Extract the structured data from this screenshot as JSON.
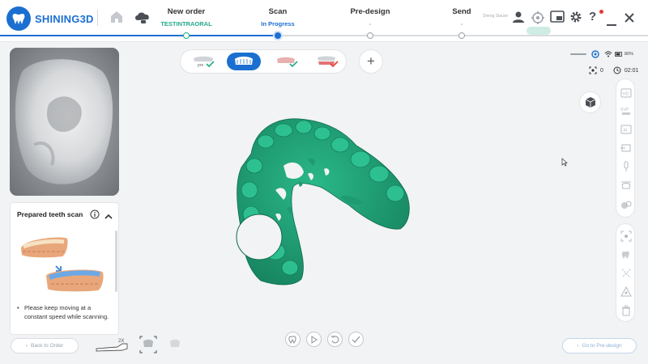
{
  "app": {
    "logo_text": "SHINING3D",
    "username": "Sheng Slause"
  },
  "steps": [
    {
      "title": "New order",
      "subtitle": "TESTINTRAORAL",
      "state": "done"
    },
    {
      "title": "Scan",
      "subtitle": "In Progress",
      "state": "active"
    },
    {
      "title": "Pre-design",
      "subtitle": "-",
      "state": "pending"
    },
    {
      "title": "Send",
      "subtitle": "-",
      "state": "pending"
    }
  ],
  "colors": {
    "brand": "#1b6fd1",
    "done": "#23a98a",
    "model": "#1e9b71"
  },
  "scan_tabs": [
    {
      "icon": "preparation-jaw-icon",
      "label": "pre",
      "active": false
    },
    {
      "icon": "upper-jaw-icon",
      "active": true
    },
    {
      "icon": "lower-jaw-icon",
      "active": false
    },
    {
      "icon": "bite-icon",
      "active": false
    }
  ],
  "add_label": "+",
  "status": {
    "battery": "80%"
  },
  "counters": {
    "shots": "0",
    "time": "02:01"
  },
  "guide": {
    "title": "Prepared teeth scan",
    "tip": "Please keep moving at a constant speed while scanning."
  },
  "bottom": {
    "back_label": "Back to Order",
    "next_label": "Go to Pre-design",
    "zoom_badge": "2X"
  },
  "right_tools_top": [
    "hd-icon",
    "svp-icon",
    "ai-icon",
    "trim-icon",
    "scanner-icon",
    "jaw-icon",
    "texture-icon"
  ],
  "right_tools_bottom": [
    "fit-icon",
    "tooth-icon",
    "select-icon",
    "landmark-icon",
    "delete-icon"
  ]
}
